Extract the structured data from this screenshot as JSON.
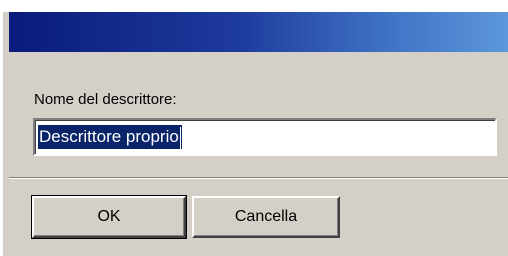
{
  "dialog": {
    "title": "",
    "field_label": "Nome del descrittore:",
    "field_value": "Descrittore proprio",
    "ok_label": "OK",
    "cancel_label": "Cancella"
  },
  "colors": {
    "title_bar_start": "#0a1b7c",
    "title_bar_end": "#5d98dc",
    "dialog_face": "#d4d0c8",
    "selection": "#0a246a"
  }
}
